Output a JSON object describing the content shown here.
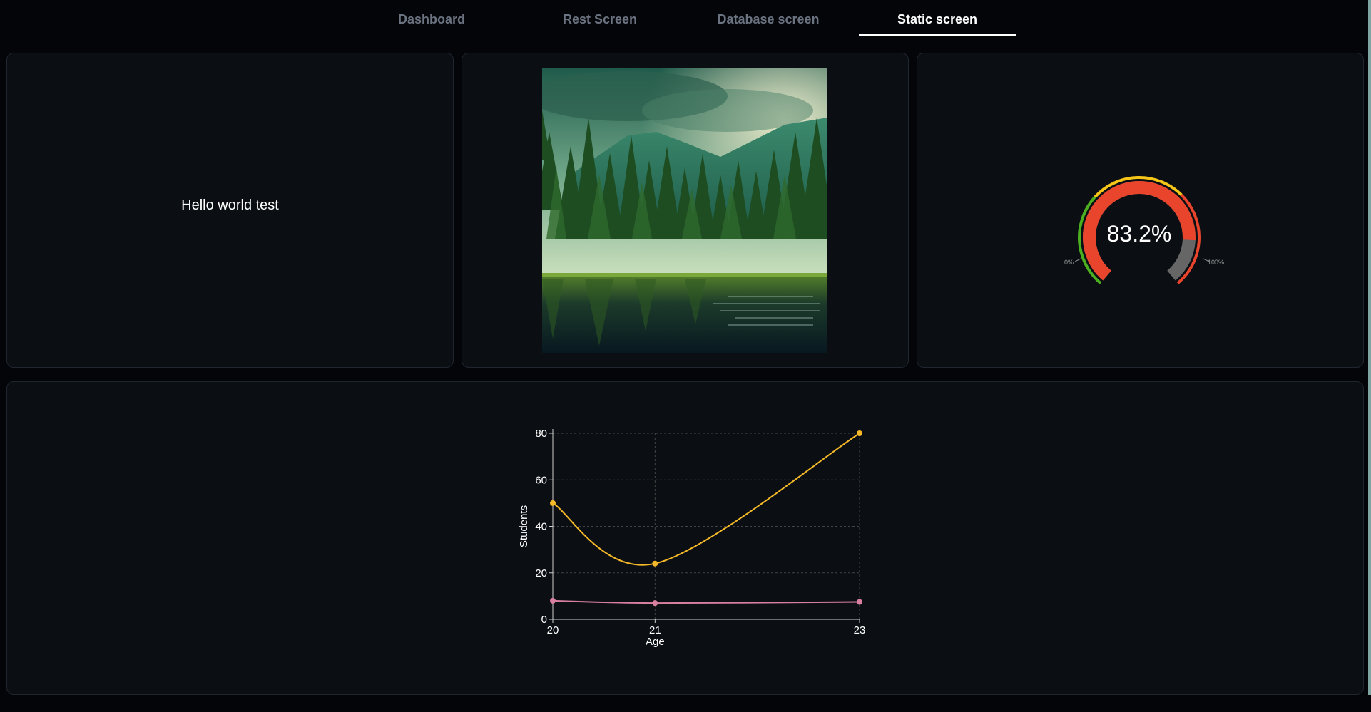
{
  "nav": {
    "tabs": [
      {
        "label": "Dashboard",
        "active": false
      },
      {
        "label": "Rest Screen",
        "active": false
      },
      {
        "label": "Database screen",
        "active": false
      },
      {
        "label": "Static screen",
        "active": true
      }
    ]
  },
  "text_card": {
    "text": "Hello world test"
  },
  "gauge": {
    "value_label": "83.2%",
    "value": 83.2,
    "min_label": "0%",
    "max_label": "100%",
    "colors": {
      "low": "#4caf1f",
      "mid": "#f5c518",
      "high": "#e8452c",
      "fill": "#e8452c",
      "track": "#666666"
    }
  },
  "chart_data": {
    "type": "line",
    "x": [
      20,
      21,
      23
    ],
    "xlabel": "Age",
    "ylabel": "Students",
    "ylim": [
      0,
      80
    ],
    "yticks": [
      0,
      20,
      40,
      60,
      80
    ],
    "grid": true,
    "series": [
      {
        "values": [
          50,
          24,
          80
        ],
        "color": "#f5b829",
        "curve": "smooth"
      },
      {
        "values": [
          8,
          7,
          7.5
        ],
        "color": "#d97fa0",
        "curve": "smooth"
      }
    ]
  }
}
